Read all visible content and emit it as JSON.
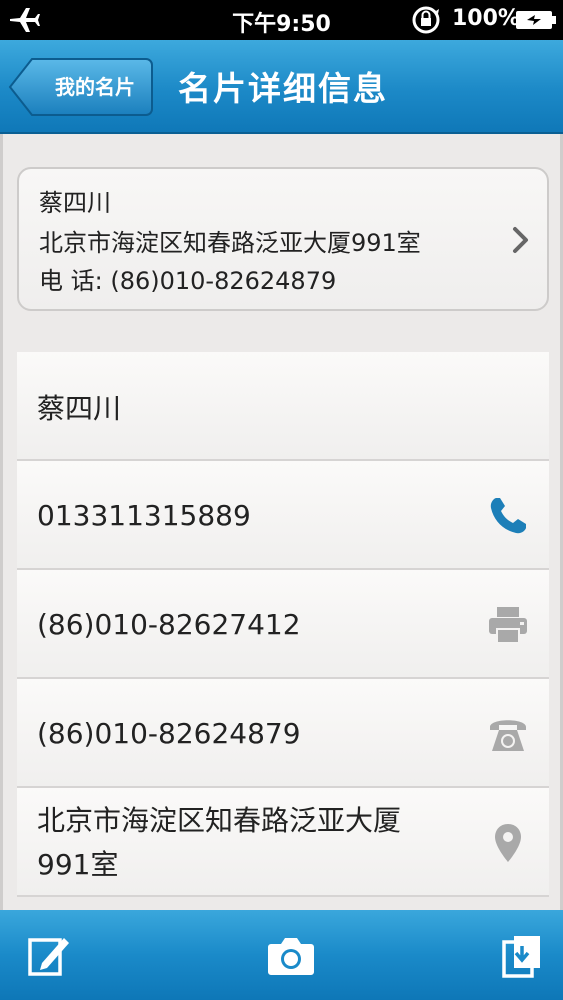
{
  "status_bar": {
    "time": "下午9:50",
    "battery_percent": "100%"
  },
  "nav": {
    "back_label": "我的名片",
    "title": "名片详细信息"
  },
  "summary": {
    "name": "蔡四川",
    "address": "北京市海淀区知春路泛亚大厦991室",
    "phone": "电 话: (86)010-82624879"
  },
  "details": {
    "name": "蔡四川",
    "mobile": "013311315889",
    "fax": "(86)010-82627412",
    "telephone": "(86)010-82624879",
    "address_line1": "北京市海淀区知春路泛亚大厦",
    "address_line2": "991室"
  },
  "icons": {
    "mobile": "phone-icon",
    "fax": "printer-icon",
    "telephone": "telephone-icon",
    "address": "location-pin-icon",
    "toolbar": [
      "edit-icon",
      "camera-icon",
      "save-contact-icon"
    ]
  },
  "colors": {
    "header_blue": "#1c89c7",
    "phone_icon_blue": "#1d7fb8",
    "icon_gray": "#a9a9a9"
  }
}
